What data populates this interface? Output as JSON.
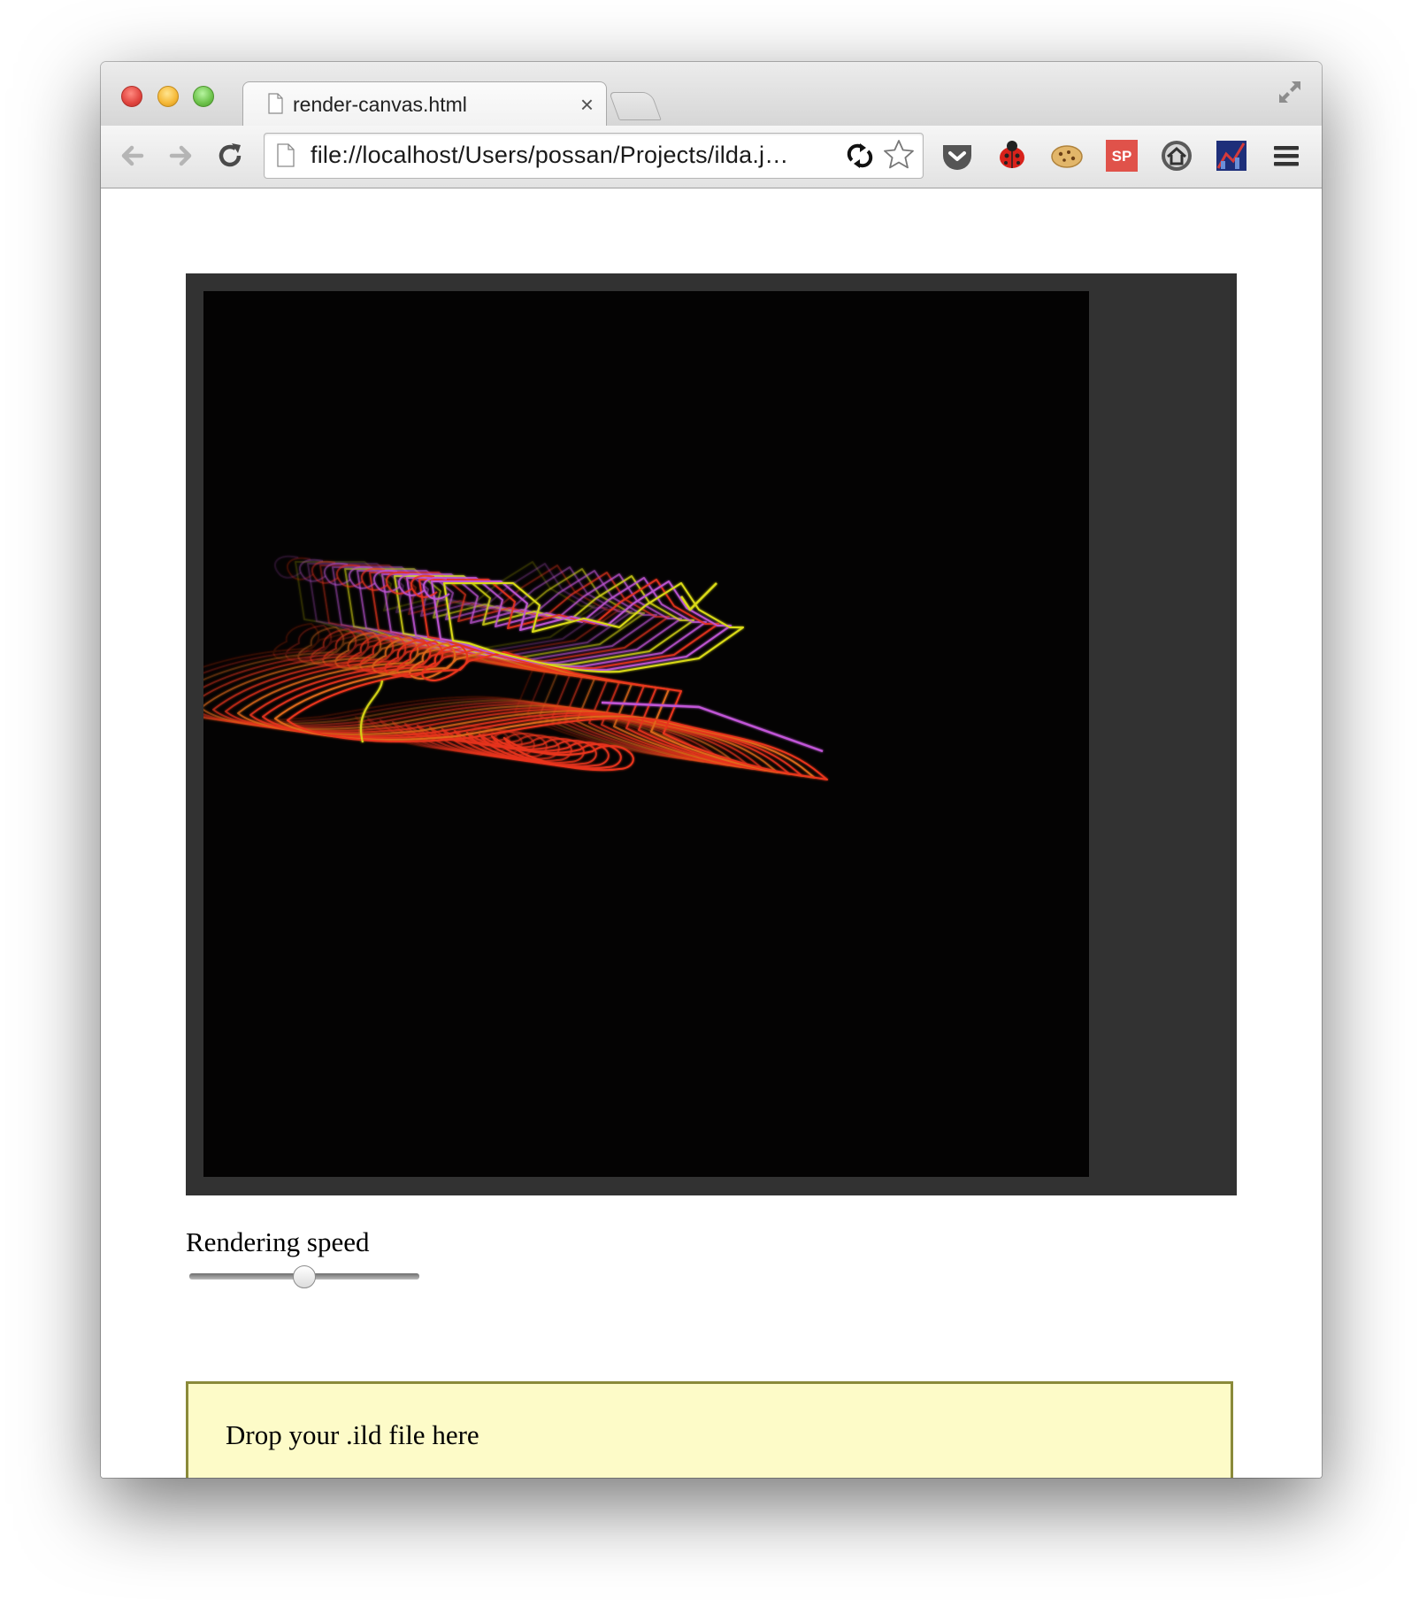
{
  "browser": {
    "tab_title": "render-canvas.html",
    "tab_close": "×",
    "url": "file://localhost/Users/possan/Projects/ilda.j…"
  },
  "page": {
    "speed_label": "Rendering speed",
    "speed_value": 0.5,
    "dropzone_text": "Drop your .ild file here"
  },
  "colors": {
    "red": "#e8341c",
    "orange": "#e06a1a",
    "yellow": "#d9d914",
    "magenta": "#c055d6",
    "dropzone_bg": "#fdfbc8",
    "canvas_bg": "#040303"
  },
  "icons": {
    "back": "back-arrow-icon",
    "forward": "forward-arrow-icon",
    "reload": "reload-icon",
    "star": "bookmark-star-icon",
    "extensions": [
      "pocket-icon",
      "ladybug-icon",
      "cookie-icon",
      "sp-icon",
      "home-icon",
      "chart-icon",
      "menu-icon"
    ]
  }
}
